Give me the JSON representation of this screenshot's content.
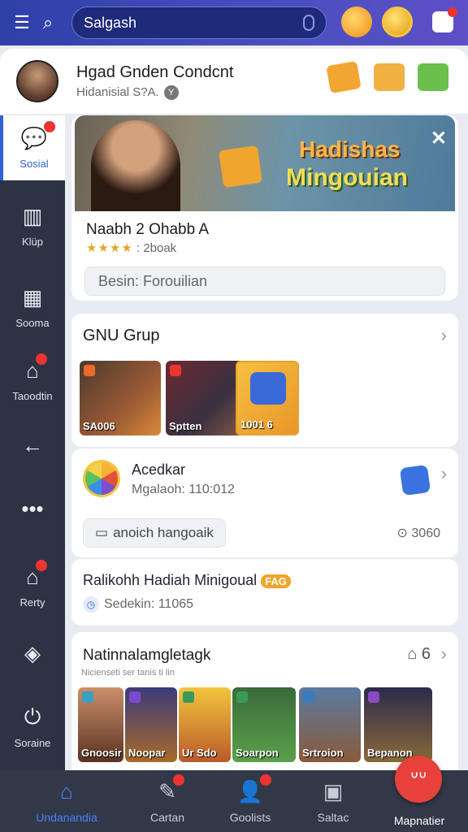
{
  "topbar": {
    "search_placeholder": "Salgash"
  },
  "header": {
    "title": "Hgad Gnden Condcnt",
    "subtitle": "Hidanisial S?A."
  },
  "sidebar": {
    "items": [
      {
        "label": "Sosial",
        "icon": "chat-icon"
      },
      {
        "label": "Klüp",
        "icon": "book-icon"
      },
      {
        "label": "Sooma",
        "icon": "store-icon"
      },
      {
        "label": "Taoodtin",
        "icon": "home-icon"
      },
      {
        "label": "",
        "icon": "back-arrow-icon"
      },
      {
        "label": "",
        "icon": "more-icon"
      },
      {
        "label": "Rerty",
        "icon": "house-icon"
      },
      {
        "label": "",
        "icon": "box-icon"
      },
      {
        "label": "Soraine",
        "icon": "power-icon"
      }
    ]
  },
  "promo": {
    "banner_line1": "Hadishas",
    "banner_line2": "Mingouian",
    "title": "Naabh 2 Ohabb A",
    "rating_text": "2boak",
    "input_text": "Besin: Forouilian"
  },
  "group": {
    "title": "GNU Grup",
    "tiles": [
      {
        "label": "SA006"
      },
      {
        "label": "Sptten"
      },
      {
        "label": "1001 6"
      }
    ]
  },
  "activity": {
    "title": "Acedkar",
    "subtitle": "Mgalaoh: 110:012",
    "pill": "anoich hangoaik",
    "count": "3060"
  },
  "weekly": {
    "title": "Ralikohh Hadiah Minigoual",
    "tag": "FAG",
    "subtitle": "Sedekin: 11065"
  },
  "national": {
    "title": "Natinnalamgletagk",
    "subtitle": "Nicienseti ser tanis ti lin",
    "count": "6",
    "tiles": [
      {
        "label": "Gnoosir"
      },
      {
        "label": "Noopar"
      },
      {
        "label": "Ur Sdo"
      },
      {
        "label": "Soarpon"
      },
      {
        "label": "Srtroion"
      },
      {
        "label": "Bepanon"
      }
    ]
  },
  "bottom_nav": {
    "items": [
      {
        "label": "Undanandia"
      },
      {
        "label": "Cartan"
      },
      {
        "label": "Goolists"
      },
      {
        "label": "Saltac"
      },
      {
        "label": "Mapnatier"
      }
    ]
  }
}
